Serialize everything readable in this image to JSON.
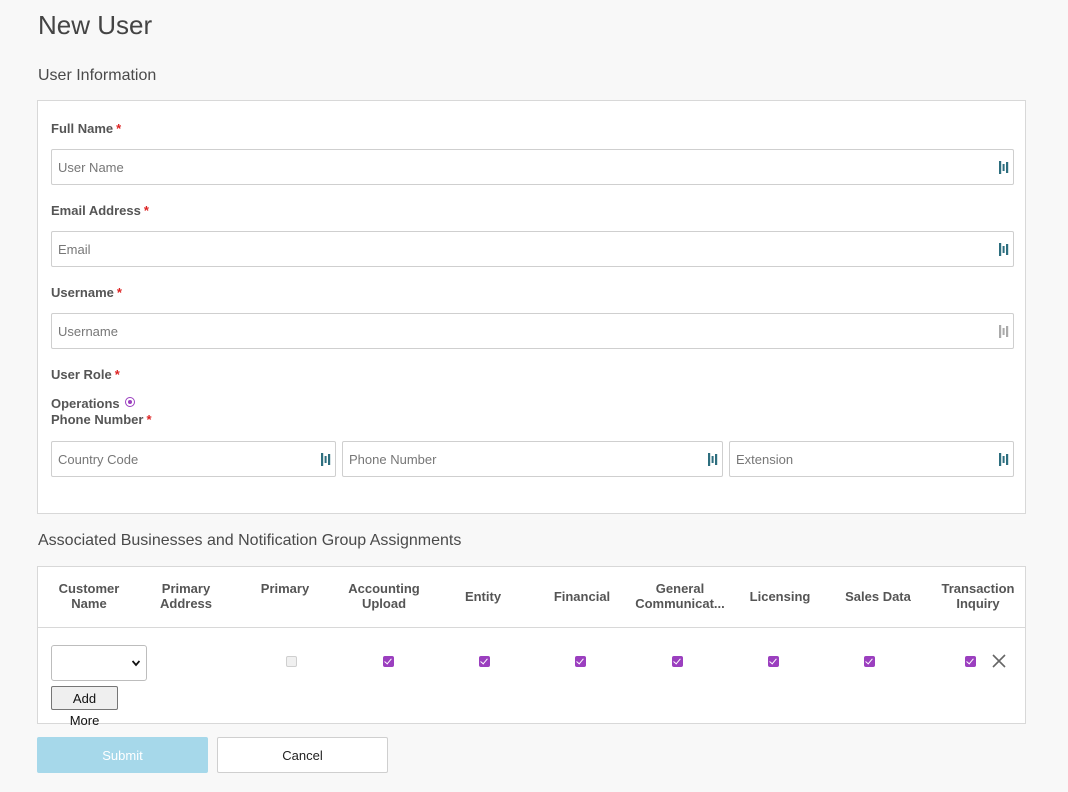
{
  "page": {
    "title": "New User"
  },
  "user_info": {
    "section_title": "User Information",
    "full_name": {
      "label": "Full Name",
      "required": "*",
      "placeholder": "User Name",
      "value": ""
    },
    "email": {
      "label": "Email Address",
      "required": "*",
      "placeholder": "Email",
      "value": ""
    },
    "username": {
      "label": "Username",
      "required": "*",
      "placeholder": "Username",
      "value": ""
    },
    "user_role": {
      "label": "User Role",
      "required": "*",
      "option": "Operations",
      "selected": true
    },
    "phone": {
      "label": "Phone Number",
      "required": "*",
      "country_code_placeholder": "Country Code",
      "number_placeholder": "Phone Number",
      "extension_placeholder": "Extension"
    }
  },
  "assignments": {
    "section_title": "Associated Businesses and Notification Group Assignments",
    "columns": {
      "customer_name": "Customer Name",
      "primary_address": "Primary Address",
      "primary": "Primary",
      "accounting_upload": "Accounting Upload",
      "entity": "Entity",
      "financial": "Financial",
      "general_communications": "General Communicat...",
      "licensing": "Licensing",
      "sales_data": "Sales Data",
      "transaction_inquiry": "Transaction Inquiry"
    },
    "row": {
      "customer_value": "",
      "primary": false,
      "accounting_upload": true,
      "entity": true,
      "financial": true,
      "general_communications": true,
      "licensing": true,
      "sales_data": true,
      "transaction_inquiry": true
    },
    "add_more_label": "Add More"
  },
  "actions": {
    "submit_label": "Submit",
    "cancel_label": "Cancel"
  },
  "colors": {
    "accent": "#9b3fbf",
    "submit_disabled": "#a6d8ea",
    "required": "#dd2222",
    "icon_teal": "#2d6e7e"
  },
  "icons": {
    "field_icon": "password-manager-icon",
    "caret": "chevron-down-icon",
    "remove": "close-icon"
  }
}
